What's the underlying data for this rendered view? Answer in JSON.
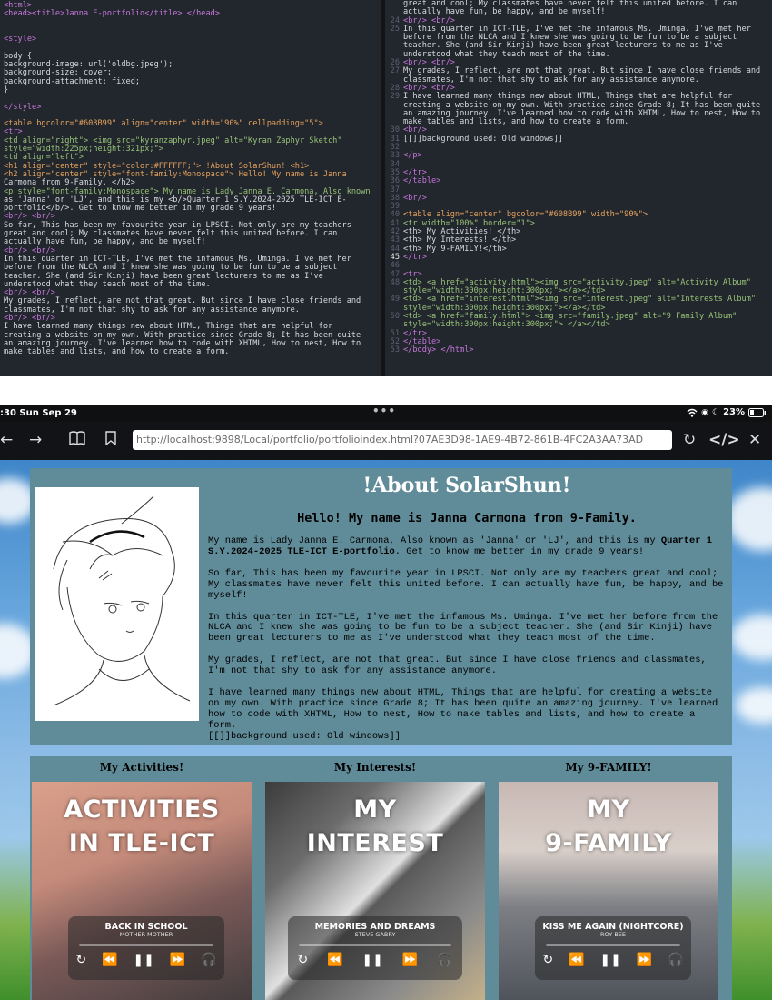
{
  "editor_left": {
    "lines": [
      {
        "text": "<html>",
        "cls": "tag"
      },
      {
        "text": "<head><title>Janna E-portfolio</title> </head>",
        "cls": "tag"
      },
      {
        "text": "",
        "cls": ""
      },
      {
        "text": "",
        "cls": ""
      },
      {
        "text": "<style>",
        "cls": "tag"
      },
      {
        "text": "",
        "cls": ""
      },
      {
        "text": "body {",
        "cls": ""
      },
      {
        "text": "background-image: url('oldbg.jpeg');",
        "cls": ""
      },
      {
        "text": "background-size: cover;",
        "cls": ""
      },
      {
        "text": "background-attachment: fixed;",
        "cls": ""
      },
      {
        "text": "}",
        "cls": ""
      },
      {
        "text": "",
        "cls": ""
      },
      {
        "text": "</style>",
        "cls": "tag"
      },
      {
        "text": "",
        "cls": ""
      },
      {
        "text": "<table bgcolor=\"#608B99\" align=\"center\" width=\"90%\" cellpadding=\"5\">",
        "cls": "orange"
      },
      {
        "text": "<tr>",
        "cls": "tag"
      },
      {
        "text": "<td align=\"right\"> <img src=\"kyranzaphyr.jpeg\" alt=\"Kyran Zaphyr Sketch\"",
        "cls": "green"
      },
      {
        "text": "style=\"width:225px;height:321px;\">",
        "cls": "green"
      },
      {
        "text": "<td align=\"left\">",
        "cls": "green"
      },
      {
        "text": "<h1 align=\"center\" style=\"color:#FFFFFF;\"> !About SolarShun! <h1>",
        "cls": "orange"
      },
      {
        "text": "<h2 align=\"center\" style=\"font-family:Monospace\"> Hello! My name is Janna",
        "cls": "orange"
      },
      {
        "text": "Carmona from 9-Family. </h2>",
        "cls": ""
      },
      {
        "text": "<p style=\"font-family:Monospace\"> My name is Lady Janna E. Carmona, Also known",
        "cls": "green"
      },
      {
        "text": "as 'Janna' or 'LJ', and this is my <b/>Quarter 1 S.Y.2024-2025 TLE-ICT E-",
        "cls": ""
      },
      {
        "text": "portfolio</b/>. Get to know me better in my grade 9 years!",
        "cls": ""
      },
      {
        "text": "<br/> <br/>",
        "cls": "tag"
      },
      {
        "text": "So far, This has been my favourite year in LPSCI. Not only are my teachers",
        "cls": ""
      },
      {
        "text": "great and cool; My classmates have never felt this united before. I can",
        "cls": ""
      },
      {
        "text": "actually have fun, be happy, and be myself!",
        "cls": ""
      },
      {
        "text": "<br/> <br/>",
        "cls": "tag"
      },
      {
        "text": "In this quarter in ICT-TLE, I've met the infamous Ms. Uminga. I've met her",
        "cls": ""
      },
      {
        "text": "before from the NLCA and I knew she was going to be fun to be a subject",
        "cls": ""
      },
      {
        "text": "teacher. She (and Sir Kinji) have been great lecturers to me as I've",
        "cls": ""
      },
      {
        "text": "understood what they teach most of the time.",
        "cls": ""
      },
      {
        "text": "<br/> <br/>",
        "cls": "tag"
      },
      {
        "text": "My grades, I reflect, are not that great. But since I have close friends and",
        "cls": ""
      },
      {
        "text": "classmates, I'm not that shy to ask for any assistance anymore.",
        "cls": ""
      },
      {
        "text": "<br/> <br/>",
        "cls": "tag"
      },
      {
        "text": "I have learned many things new about HTML, Things that are helpful for",
        "cls": ""
      },
      {
        "text": "creating a website on my own. With practice since Grade 8; It has been quite",
        "cls": ""
      },
      {
        "text": "an amazing journey. I've learned how to code with XHTML, How to nest, How to",
        "cls": ""
      },
      {
        "text": "make tables and lists, and how to create a form.",
        "cls": ""
      }
    ]
  },
  "editor_right": {
    "lines": [
      {
        "num": "",
        "text": "great and cool; My classmates have never felt this united before. I can",
        "cls": ""
      },
      {
        "num": "",
        "text": "actually have fun, be happy, and be myself!",
        "cls": ""
      },
      {
        "num": "24",
        "text": "<br/> <br/>",
        "cls": "tag"
      },
      {
        "num": "25",
        "text": "In this quarter in ICT-TLE, I've met the infamous Ms. Uminga. I've met her",
        "cls": ""
      },
      {
        "num": "",
        "text": "before from the NLCA and I knew she was going to be fun to be a subject",
        "cls": ""
      },
      {
        "num": "",
        "text": "teacher. She (and Sir Kinji) have been great lecturers to me as I've",
        "cls": ""
      },
      {
        "num": "",
        "text": "understood what they teach most of the time.",
        "cls": ""
      },
      {
        "num": "26",
        "text": "<br/> <br/>",
        "cls": "tag"
      },
      {
        "num": "27",
        "text": "My grades, I reflect, are not that great. But since I have close friends and",
        "cls": ""
      },
      {
        "num": "",
        "text": "classmates, I'm not that shy to ask for any assistance anymore.",
        "cls": ""
      },
      {
        "num": "28",
        "text": "<br/> <br/>",
        "cls": "tag"
      },
      {
        "num": "29",
        "text": "I have learned many things new about HTML, Things that are helpful for",
        "cls": ""
      },
      {
        "num": "",
        "text": "creating a website on my own. With practice since Grade 8; It has been quite",
        "cls": ""
      },
      {
        "num": "",
        "text": "an amazing journey. I've learned how to code with XHTML, How to nest, How to",
        "cls": ""
      },
      {
        "num": "",
        "text": "make tables and lists, and how to create a form.",
        "cls": ""
      },
      {
        "num": "30",
        "text": "<br/>",
        "cls": "tag"
      },
      {
        "num": "31",
        "text": "[[]]background used: Old windows]]",
        "cls": ""
      },
      {
        "num": "32",
        "text": "",
        "cls": ""
      },
      {
        "num": "33",
        "text": "</p>",
        "cls": "tag"
      },
      {
        "num": "34",
        "text": "",
        "cls": ""
      },
      {
        "num": "35",
        "text": "</tr>",
        "cls": "tag"
      },
      {
        "num": "36",
        "text": "</table>",
        "cls": "tag"
      },
      {
        "num": "37",
        "text": "",
        "cls": ""
      },
      {
        "num": "38",
        "text": "<br/>",
        "cls": "tag"
      },
      {
        "num": "39",
        "text": "",
        "cls": ""
      },
      {
        "num": "40",
        "text": "<table align=\"center\" bgcolor=\"#608B99\" width=\"90%\">",
        "cls": "orange"
      },
      {
        "num": "41",
        "text": "<tr width=\"100%\" border=\"1\">",
        "cls": "green"
      },
      {
        "num": "42",
        "text": "<th> My Activities! </th>",
        "cls": ""
      },
      {
        "num": "43",
        "text": "<th> My Interests! </th>",
        "cls": ""
      },
      {
        "num": "44",
        "text": "<th> My 9-FAMILY!</th>",
        "cls": ""
      },
      {
        "num": "45",
        "text": "</tr>",
        "cls": "tag",
        "current": true
      },
      {
        "num": "46",
        "text": "",
        "cls": ""
      },
      {
        "num": "47",
        "text": "<tr>",
        "cls": "tag"
      },
      {
        "num": "48",
        "text": "<td> <a href=\"activity.html\"><img src=\"activity.jpeg\" alt=\"Activity Album\"",
        "cls": "green"
      },
      {
        "num": "",
        "text": "style=\"width:300px;height:300px;\"></a></td>",
        "cls": "green"
      },
      {
        "num": "49",
        "text": "<td> <a href=\"interest.html\"><img src=\"interest.jpeg\" alt=\"Interests Album\"",
        "cls": "green"
      },
      {
        "num": "",
        "text": "style=\"width:300px;height:300px;\"></a></td>",
        "cls": "green"
      },
      {
        "num": "50",
        "text": "<td> <a href=\"family.html\"> <img src=\"family.jpeg\" alt=\"9 Family Album\"",
        "cls": "green"
      },
      {
        "num": "",
        "text": "style=\"width:300px;height:300px;\"> </a></td>",
        "cls": "green"
      },
      {
        "num": "51",
        "text": "</tr>",
        "cls": "tag"
      },
      {
        "num": "52",
        "text": "</table>",
        "cls": "tag"
      },
      {
        "num": "53",
        "text": "</body> </html>",
        "cls": "tag"
      }
    ]
  },
  "statusbar": {
    "time": ":30  Sun Sep 29",
    "dots": "•••",
    "battery": "23%"
  },
  "browser": {
    "url": "http://localhost:9898/Local/portfolio/portfolioindex.html?07AE3D98-1AE9-4B72-861B-4FC2A3AA73AD"
  },
  "about": {
    "heading": "!About SolarShun!",
    "subheading": "Hello! My name is Janna Carmona from 9-Family.",
    "p1_pre": "My name is Lady Janna E. Carmona, Also known as 'Janna' or 'LJ', and this is my ",
    "p1_bold": "Quarter 1 S.Y.2024-2025 TLE-ICT E-portfolio",
    "p1_post": ". Get to know me better in my grade 9 years!",
    "p2": "So far, This has been my favourite year in LPSCI. Not only are my teachers great and cool; My classmates have never felt this united before. I can actually have fun, be happy, and be myself!",
    "p3": "In this quarter in ICT-TLE, I've met the infamous Ms. Uminga. I've met her before from the NLCA and I knew she was going to be fun to be a subject teacher. She (and Sir Kinji) have been great lecturers to me as I've understood what they teach most of the time.",
    "p4": "My grades, I reflect, are not that great. But since I have close friends and classmates, I'm not that shy to ask for any assistance anymore.",
    "p5": "I have learned many things new about HTML, Things that are helpful for creating a website on my own. With practice since Grade 8; It has been quite an amazing journey. I've learned how to code with XHTML, How to nest, How to make tables and lists, and how to create a form.",
    "p6": "[[]]background used: Old windows]]"
  },
  "albums": [
    {
      "header": "My Activities!",
      "title1": "ACTIVITIES",
      "title2": "IN TLE-ICT",
      "song": "BACK IN SCHOOL",
      "artist": "MOTHER MOTHER"
    },
    {
      "header": "My Interests!",
      "title1": "MY",
      "title2": "INTEREST",
      "song": "MEMORIES AND DREAMS",
      "artist": "STEVE GABRY"
    },
    {
      "header": "My 9-FAMILY!",
      "title1": "MY",
      "title2": "9-FAMILY",
      "song": "KISS ME AGAIN (NIGHTCORE)",
      "artist": "ROY BEE"
    }
  ],
  "colors": {
    "table_bg": "#608B99",
    "editor_bg": "#22262d"
  }
}
